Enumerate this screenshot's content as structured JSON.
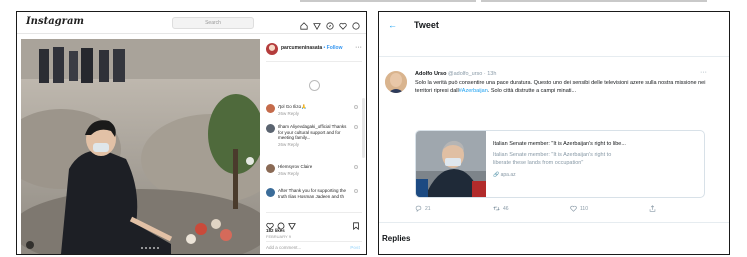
{
  "instagram": {
    "logo": "Instagram",
    "search_placeholder": "Search",
    "nav_icons": [
      "home-icon",
      "direct-icon",
      "explore-icon",
      "heart-icon",
      "profile-icon"
    ],
    "author": {
      "username": "parcumeninasata",
      "follow_label": "• Follow"
    },
    "comments": [
      {
        "text": "Ӆol Go Ilizɑ🙏",
        "meta": "26w  Reply"
      },
      {
        "text": "Ilham Aliyevdagaki_official Thanks for your cultural support and for meeting family...",
        "meta": "26w  Reply"
      },
      {
        "text": "Hlemsyrov Claire",
        "meta": "26w  Reply"
      },
      {
        "text": "After Thank you for supporting the truth Ilias Hosman Jadeen and th",
        "meta": ""
      }
    ],
    "likes": "182 likes",
    "date": "FEBRUARY 9",
    "add_comment_placeholder": "Add a comment...",
    "post_label": "Post"
  },
  "twitter": {
    "page_title": "Tweet",
    "author_name": "Adolfo Urso",
    "author_handle": "@adolfo_urso · 13h",
    "body_text": "Solo la verità può consentire una pace duratura. Questo uno dei sensibi delle televisioni azere sulla nostra missione nei territori ripresi dall",
    "body_link": "#Azerbaijan",
    "body_text_end": ". Solo città distrutte a campi minati...",
    "card": {
      "title": "Italian Senate member: \"It is Azerbaijan's right to libe...",
      "description": "Italian Senate member: \"It is Azerbaijan's right to liberate these lands from occupation\"",
      "domain": "apa.az"
    },
    "actions": {
      "reply_count": "21",
      "retweet_count": "46",
      "like_count": "110"
    },
    "replies_heading": "Replies",
    "colors": {
      "accent": "#1da1f2",
      "muted": "#8899a6"
    }
  }
}
